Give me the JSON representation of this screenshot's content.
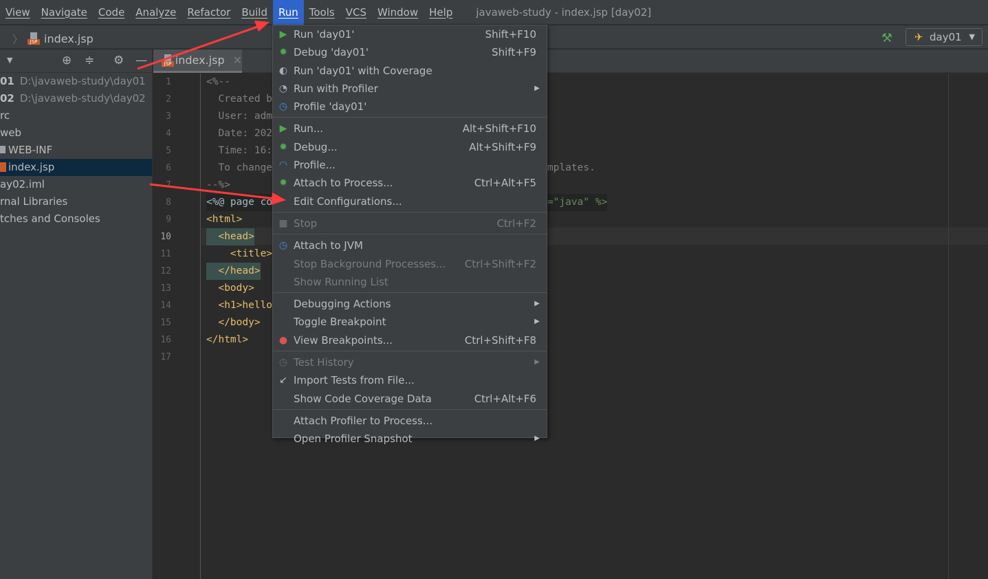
{
  "menubar": {
    "items": [
      "View",
      "Navigate",
      "Code",
      "Analyze",
      "Refactor",
      "Build",
      "Run",
      "Tools",
      "VCS",
      "Window",
      "Help"
    ],
    "active": "Run",
    "window_title": "javaweb-study - index.jsp [day02]"
  },
  "navbar": {
    "breadcrumb": "index.jsp",
    "run_config": "day01"
  },
  "project_tree": [
    {
      "label": "01",
      "path": "D:\\javaweb-study\\day01"
    },
    {
      "label": "02",
      "path": "D:\\javaweb-study\\day02"
    },
    {
      "label": "rc"
    },
    {
      "label": "web"
    },
    {
      "label": "WEB-INF"
    },
    {
      "label": "index.jsp",
      "selected": true
    },
    {
      "label": "ay02.iml"
    },
    {
      "label": "rnal Libraries"
    },
    {
      "label": "tches and Consoles"
    }
  ],
  "editor": {
    "tab": "index.jsp",
    "current_line": 10,
    "lines": [
      "<%--",
      "  Created b",
      "  User: adm",
      "  Date: 202",
      "  Time: 16:",
      "  To change",
      "--%>",
      "<%@ page co",
      "<html>",
      "  <head>",
      "    <title>",
      "  </head>",
      "  <body>",
      "  <h1>hello",
      "  </body>",
      "</html>",
      ""
    ],
    "overflow": {
      "6": "mplates.",
      "8": "=\"java\" %>"
    }
  },
  "run_menu": [
    {
      "label": "Run 'day01'",
      "shortcut": "Shift+F10",
      "icon": "play-icon"
    },
    {
      "label": "Debug 'day01'",
      "shortcut": "Shift+F9",
      "icon": "bug-icon"
    },
    {
      "label": "Run 'day01' with Coverage",
      "icon": "coverage-icon"
    },
    {
      "label": "Run with Profiler",
      "submenu": true,
      "icon": "profiler-icon"
    },
    {
      "label": "Profile 'day01'",
      "icon": "gauge-icon"
    },
    {
      "sep": true
    },
    {
      "label": "Run...",
      "shortcut": "Alt+Shift+F10",
      "icon": "play-icon"
    },
    {
      "label": "Debug...",
      "shortcut": "Alt+Shift+F9",
      "icon": "bug-icon"
    },
    {
      "label": "Profile...",
      "icon": "speedometer-icon"
    },
    {
      "label": "Attach to Process...",
      "shortcut": "Ctrl+Alt+F5",
      "icon": "attach-bug-icon"
    },
    {
      "label": "Edit Configurations..."
    },
    {
      "sep": true
    },
    {
      "label": "Stop",
      "shortcut": "Ctrl+F2",
      "disabled": true,
      "icon": "stop-icon"
    },
    {
      "sep": true
    },
    {
      "label": "Attach to JVM",
      "icon": "gauge-icon"
    },
    {
      "label": "Stop Background Processes...",
      "shortcut": "Ctrl+Shift+F2",
      "disabled": true
    },
    {
      "label": "Show Running List",
      "disabled": true
    },
    {
      "sep": true
    },
    {
      "label": "Debugging Actions",
      "submenu": true
    },
    {
      "label": "Toggle Breakpoint",
      "submenu": true
    },
    {
      "label": "View Breakpoints...",
      "shortcut": "Ctrl+Shift+F8",
      "icon": "breakpoints-icon"
    },
    {
      "sep": true
    },
    {
      "label": "Test History",
      "submenu": true,
      "disabled": true,
      "icon": "clock-icon"
    },
    {
      "label": "Import Tests from File...",
      "icon": "import-icon"
    },
    {
      "label": "Show Code Coverage Data",
      "shortcut": "Ctrl+Alt+F6"
    },
    {
      "sep": true
    },
    {
      "label": "Attach Profiler to Process..."
    },
    {
      "label": "Open Profiler Snapshot",
      "submenu": true
    }
  ],
  "colors": {
    "menu_highlight": "#2f65ca",
    "annotation_arrow": "#ff3b3b",
    "selection": "#0d293e"
  }
}
